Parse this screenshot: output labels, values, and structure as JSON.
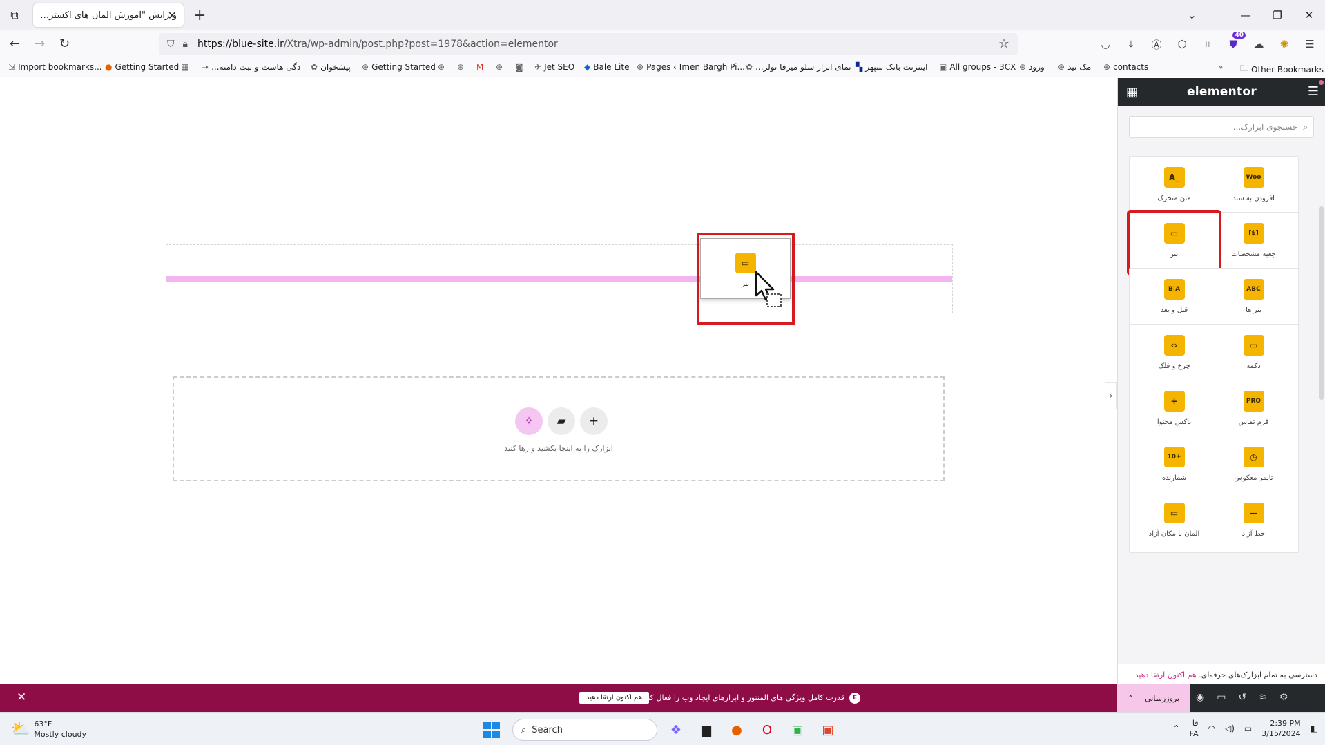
{
  "browser": {
    "tab": {
      "title": "ویرایش \"آموزش المان های اکسترا – ...\""
    },
    "url": {
      "host": "https://blue-site.ir",
      "path": "/Xtra/wp-admin/post.php?post=1978&action=elementor"
    },
    "extension_badge": "40",
    "bookmarks": [
      "Import bookmarks...",
      "Getting Started",
      "...دگی هاست و ثبت دامنه",
      "پیشخوان",
      "Getting Started",
      "Jet SEO",
      "Bale Lite",
      "Pages ‹ Imen Bargh Pi...",
      "...نمای ابزار سلو میزفا تولز",
      "اینترنت بانک سپهر",
      "All groups - 3CX",
      "ورود",
      "مک نید",
      "contacts"
    ],
    "other_bookmarks": "Other Bookmarks"
  },
  "canvas": {
    "drag_card_label": "بنر",
    "empty_section_text": "ابزارک را به اینجا بکشید و رها کنید"
  },
  "panel": {
    "logo": "elementor",
    "search_placeholder": "جستجوی ابزارک...",
    "widgets": [
      {
        "label": "افزودن به سبد",
        "icon": "woo-icon",
        "glyph": "Woo"
      },
      {
        "label": "متن متحرک",
        "icon": "animated-text-icon",
        "glyph": "A_"
      },
      {
        "label": "جعبه مشخصات",
        "icon": "price-table-icon",
        "glyph": "[$]"
      },
      {
        "label": "بنر",
        "icon": "banner-icon",
        "glyph": "▭"
      },
      {
        "label": "بنر ها",
        "icon": "banners-icon",
        "glyph": "ABC"
      },
      {
        "label": "قبل و بعد",
        "icon": "before-after-icon",
        "glyph": "B|A"
      },
      {
        "label": "دکمه",
        "icon": "button-icon",
        "glyph": "▭"
      },
      {
        "label": "چرخ و فلک",
        "icon": "carousel-icon",
        "glyph": "‹›"
      },
      {
        "label": "فرم تماس",
        "icon": "contact-form-icon",
        "glyph": "PRO"
      },
      {
        "label": "باکس محتوا",
        "icon": "content-box-icon",
        "glyph": "+"
      },
      {
        "label": "تایمر معکوس",
        "icon": "countdown-icon",
        "glyph": "◷"
      },
      {
        "label": "شمارنده",
        "icon": "counter-icon",
        "glyph": "10+"
      },
      {
        "label": "خط آزاد",
        "icon": "divider-icon",
        "glyph": "—"
      },
      {
        "label": "المان با مکان آزاد",
        "icon": "free-position-icon",
        "glyph": "▭"
      }
    ],
    "upgrade_note": "دسترسی به تمام ابزارک‌های حرفه‌ای.",
    "upgrade_link": "هم اکنون ارتقا دهید",
    "update_button": "بروزرسانی"
  },
  "promo": {
    "text": "قدرت کامل ویژگی های المنتور و ابزارهای ایجاد وب را فعال کنید.",
    "button": "هم اکنون ارتقا دهید"
  },
  "taskbar": {
    "temperature": "63°F",
    "weather": "Mostly cloudy",
    "search": "Search",
    "lang_top": "فا",
    "lang_bottom": "FA",
    "time": "2:39 PM",
    "date": "3/15/2024"
  }
}
